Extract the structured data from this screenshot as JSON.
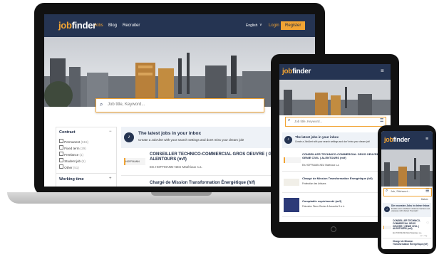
{
  "brand": {
    "logo_accent": "job",
    "logo_rest": "finder",
    "navy": "#253452",
    "orange": "#f2a433"
  },
  "laptop": {
    "nav": {
      "jobs": "Jobs",
      "blog": "Blog",
      "recruiter": "Recruiter",
      "language": "English",
      "login": "Login",
      "register": "Register"
    },
    "search_placeholder": "Job title, Keyword...",
    "filters": {
      "contract_title": "Contract",
      "items": [
        {
          "label": "Permanent",
          "count": "(615)"
        },
        {
          "label": "Fixed term",
          "count": "(29)"
        },
        {
          "label": "Freelance",
          "count": "(1)"
        },
        {
          "label": "Student job",
          "count": "(5)"
        },
        {
          "label": "Other",
          "count": "(51)"
        }
      ],
      "working_time_title": "Working time"
    },
    "feed": {
      "title": "The latest jobs in your inbox",
      "subtitle": "Create a JobAlert with your search settings and don't miss your dream job!"
    },
    "jobs": [
      {
        "logo": "HOFFMANN",
        "title": "CONSEILLER TECHNICO-COMMERCIAL GROS OEUVRE ( GENIE CIVIL ) ALENTOURS (m/f)",
        "company": "Ets HOFFMANN-NEU Matériaux s.a."
      },
      {
        "title": "Chargé de Mission Transformation Énergétique (h/f)"
      }
    ]
  },
  "tablet": {
    "search_placeholder": "Job title, Keyword...",
    "feed": {
      "title": "The latest jobs in your inbox",
      "subtitle": "Create a JobAlert with your search settings and don't miss your dream job!"
    },
    "jobs": [
      {
        "title": "CONSEILLER TECHNICO-COMMERCIAL GROS OEUVRE ( GENIE CIVIL ) ALENTOURS (m/f)",
        "company": "Ets HOFFMANN-NEU Matériaux s.a."
      },
      {
        "title": "Chargé de Mission Transformation Énergétique (h/f)",
        "company": "Fédération des Artisans"
      },
      {
        "title": "Comptable expérimenté (m/f)",
        "company": "Fiduciaire Pierre Reuter & Associés S.à r.l."
      }
    ]
  },
  "phone": {
    "search_placeholder": "Job, Stichwort...",
    "sort_label": "Datum",
    "feed": {
      "title": "Die neuesten Jobs in deiner Inbox",
      "subtitle": "Erstelle einen JobAlert mit deinen Suchein und verpasse nicht deinen Traumjob!"
    },
    "jobs": [
      {
        "title": "CONSEILLER TECHNICO-COMMERCIAL GROS OEUVRE ( GENIE CIVIL ) ALENTOURS (m/f)",
        "company": "Ets HOFFMANN-NEU Matériaux s.a.",
        "date": "vor 1 Tag"
      },
      {
        "title": "Chargé de Mission Transformation Énergétique (h/f)"
      }
    ]
  }
}
